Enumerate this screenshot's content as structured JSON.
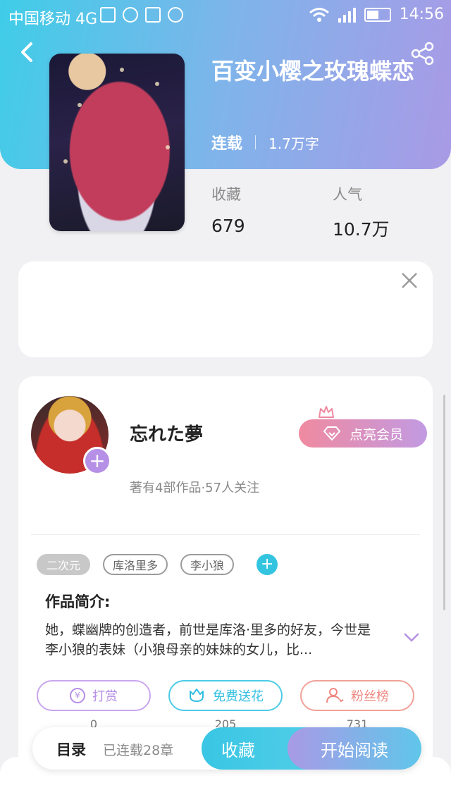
{
  "status_bar": {
    "carrier": "中国移动 4G",
    "network": "4G",
    "time": "14:56"
  },
  "book": {
    "title": "百变小樱之玫瑰蝶恋",
    "status": "连载",
    "words": "1.7万字",
    "stats": [
      {
        "label": "收藏",
        "value": "679"
      },
      {
        "label": "人气",
        "value": "10.7万"
      }
    ]
  },
  "author": {
    "name": "忘れた夢",
    "info": "著有4部作品·57人关注",
    "vip_label": "点亮会员"
  },
  "tags": [
    "二次元",
    "库洛里多",
    "李小狼"
  ],
  "intro": {
    "title": "作品简介:",
    "text": "她，蝶幽牌的创造者，前世是库洛·里多的好友，今世是李小狼的表妹（小狼母亲的妹妹的女儿，比..."
  },
  "actions": [
    {
      "label": "打赏",
      "count": "0",
      "icon": "yen-icon"
    },
    {
      "label": "免费送花",
      "count": "205",
      "icon": "flower-icon"
    },
    {
      "label": "粉丝榜",
      "count": "731",
      "icon": "fans-icon"
    }
  ],
  "bottom_bar": {
    "toc_label": "目录",
    "toc_info": "已连载28章",
    "favorite_label": "收藏",
    "read_label": "开始阅读"
  },
  "colors": {
    "header_gradient_start": "#3fcde8",
    "header_gradient_end": "#a99ae6",
    "accent_cyan": "#33c4e0",
    "accent_purple": "#b590e6",
    "accent_pink": "#f08aa0"
  }
}
